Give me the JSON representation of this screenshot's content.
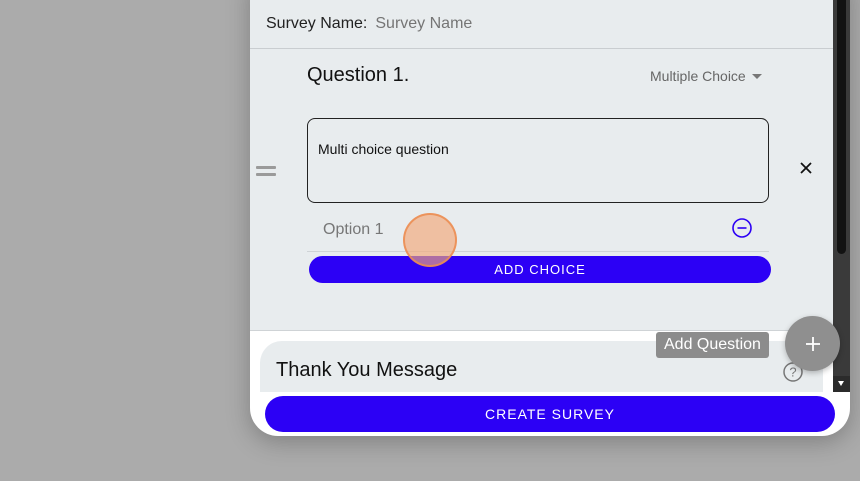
{
  "survey": {
    "name_label": "Survey Name:",
    "name_placeholder": "Survey Name"
  },
  "question": {
    "title": "Question 1.",
    "type": "Multiple Choice",
    "text": "Multi choice question",
    "options": [
      "Option 1"
    ],
    "add_choice_label": "ADD CHOICE"
  },
  "thank_you": {
    "title": "Thank You Message"
  },
  "actions": {
    "create_survey_label": "CREATE SURVEY",
    "add_question_tooltip": "Add Question"
  },
  "icons": {
    "drag": "drag-handle-icon",
    "close": "close-icon",
    "remove": "remove-circle-icon",
    "help": "help-circle-icon",
    "add": "plus-icon"
  },
  "colors": {
    "primary": "#2c00f5",
    "remove_icon": "#2c00f5",
    "fab": "#8f8f8f"
  }
}
